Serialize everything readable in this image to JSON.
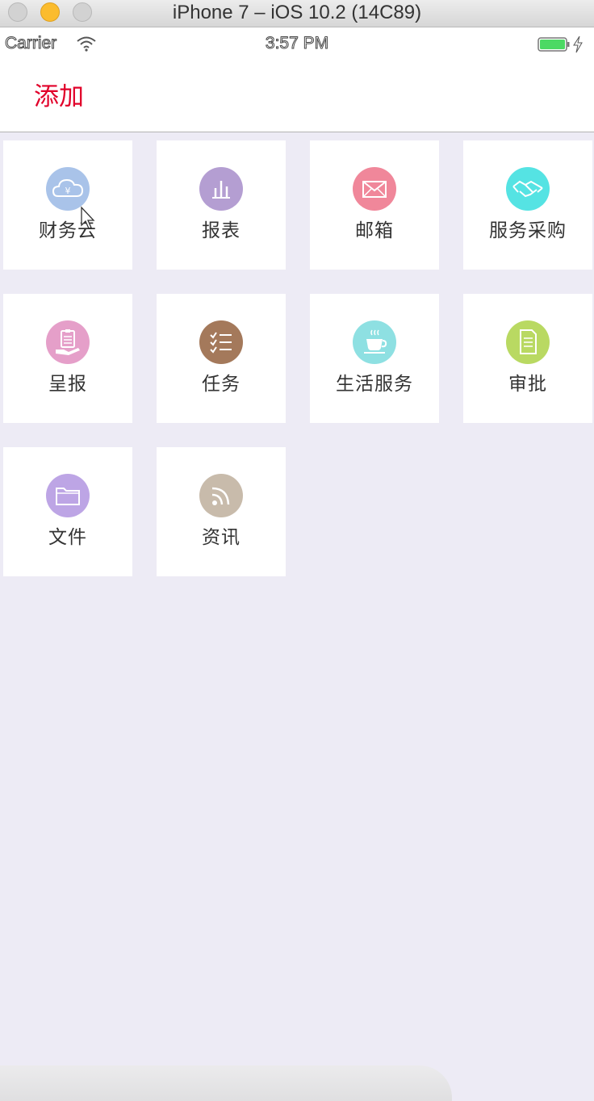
{
  "window": {
    "title": "iPhone 7 – iOS 10.2 (14C89)"
  },
  "status_bar": {
    "carrier": "Carrier",
    "time": "3:57 PM"
  },
  "nav": {
    "add_label": "添加"
  },
  "tiles": [
    {
      "label": "财务云",
      "icon": "cloud-yen-icon",
      "color": "#a9c3e9"
    },
    {
      "label": "报表",
      "icon": "bar-chart-icon",
      "color": "#b49ed2"
    },
    {
      "label": "邮箱",
      "icon": "envelope-icon",
      "color": "#f0879a"
    },
    {
      "label": "服务采购",
      "icon": "handshake-icon",
      "color": "#55e3e3"
    },
    {
      "label": "呈报",
      "icon": "clipboard-hand-icon",
      "color": "#e59fc9"
    },
    {
      "label": "任务",
      "icon": "checklist-icon",
      "color": "#a4795b"
    },
    {
      "label": "生活服务",
      "icon": "coffee-cup-icon",
      "color": "#8ee0e2"
    },
    {
      "label": "审批",
      "icon": "document-icon",
      "color": "#b9d962"
    },
    {
      "label": "文件",
      "icon": "folder-icon",
      "color": "#bda5e5"
    },
    {
      "label": "资讯",
      "icon": "rss-icon",
      "color": "#c8bbab"
    }
  ]
}
